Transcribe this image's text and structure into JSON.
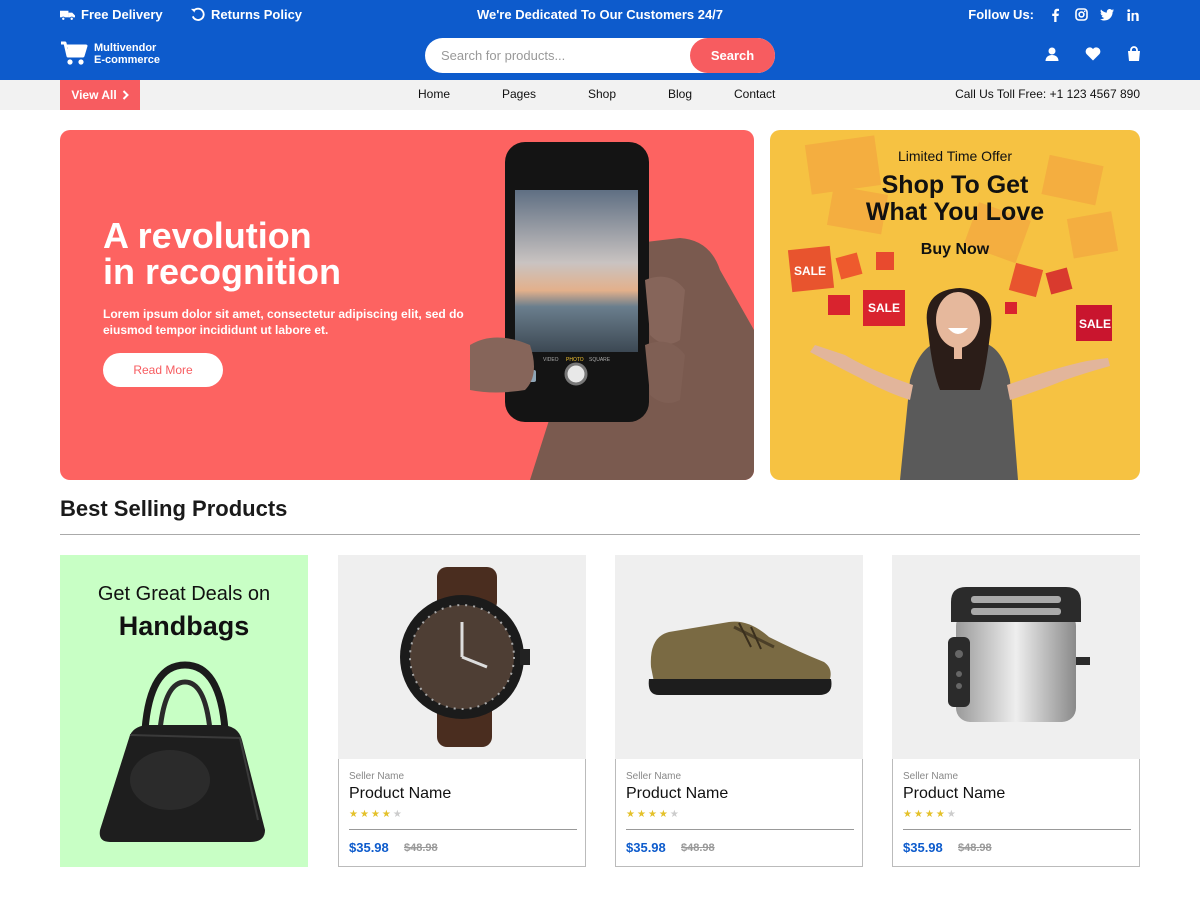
{
  "topbar": {
    "delivery": "Free Delivery",
    "returns": "Returns Policy",
    "tagline": "We're Dedicated To Our Customers 24/7",
    "follow": "Follow Us:"
  },
  "header": {
    "logo_line1": "Multivendor",
    "logo_line2": "E-commerce",
    "search_placeholder": "Search for products...",
    "search_button": "Search"
  },
  "nav": {
    "view_all": "View All",
    "links": [
      "Home",
      "Pages",
      "Shop",
      "Blog",
      "Contact"
    ],
    "call_us": "Call Us Toll Free: +1 123 4567 890"
  },
  "hero": {
    "title_line1": "A revolution",
    "title_line2": "in recognition",
    "text": "Lorem ipsum dolor sit amet, consectetur adipiscing elit, sed do eiusmod tempor incididunt ut labore et.",
    "button": "Read More",
    "camera_modes": [
      "VIDEO",
      "PHOTO",
      "SQUARE"
    ]
  },
  "promo": {
    "limited": "Limited Time Offer",
    "title_line1": "Shop To Get",
    "title_line2": "What You Love",
    "button": "Buy Now",
    "tag": "SALE"
  },
  "best_selling": {
    "title": "Best Selling Products",
    "deal_line1": "Get Great Deals on",
    "deal_line2": "Handbags",
    "products": [
      {
        "seller": "Seller Name",
        "name": "Product Name",
        "rating": 4,
        "price": "$35.98",
        "old_price": "$48.98",
        "image": "wristwatch"
      },
      {
        "seller": "Seller Name",
        "name": "Product Name",
        "rating": 4,
        "price": "$35.98",
        "old_price": "$48.98",
        "image": "shoe"
      },
      {
        "seller": "Seller Name",
        "name": "Product Name",
        "rating": 4,
        "price": "$35.98",
        "old_price": "$48.98",
        "image": "toaster"
      }
    ]
  },
  "colors": {
    "primary": "#0d5bcc",
    "accent": "#f75c60",
    "hero_bg": "#fd6361",
    "promo_bg": "#f6c242",
    "deal_bg": "#c8ffc5"
  }
}
